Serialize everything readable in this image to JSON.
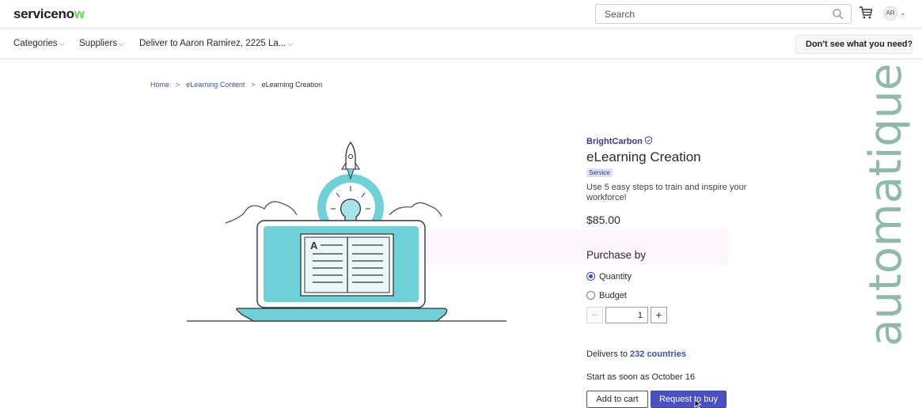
{
  "header": {
    "logo_main": "servicen",
    "logo_o": "o",
    "logo_w": "w",
    "search_placeholder": "Search",
    "avatar_initials": "AR",
    "icons": [
      "search-icon",
      "cart-icon",
      "chevron-down-icon"
    ]
  },
  "nav": {
    "categories": "Categories",
    "suppliers": "Suppliers",
    "deliver_to": "Deliver to Aaron Ramirez, 2225 La...",
    "help_button": "Don't see what you need?"
  },
  "watermark": "automatique",
  "breadcrumb": {
    "home": "Home",
    "category": "eLearning Content",
    "current": "eLearning Creation",
    "separator": ">"
  },
  "illustration": {
    "book_letter": "A"
  },
  "product": {
    "vendor": "BrightCarbon",
    "title": "eLearning Creation",
    "tag": "Service",
    "description": "Use 5 easy steps to train and inspire your workforce!",
    "price": "$85.00",
    "purchase_by_label": "Purchase by",
    "purchase_options": [
      {
        "label": "Quantity",
        "selected": true
      },
      {
        "label": "Budget",
        "selected": false
      }
    ],
    "quantity": "1",
    "minus": "−",
    "plus": "+",
    "delivers_prefix": "Delivers to ",
    "delivers_link": "232 countries",
    "start_text": "Start as soon as October 16",
    "add_to_cart": "Add to cart",
    "request_to_buy": "Request to buy"
  },
  "colors": {
    "accent": "#4a4fc4",
    "link": "#3b4fb4",
    "illustration_teal": "#5fcad3",
    "watermark": "#7aae98"
  }
}
